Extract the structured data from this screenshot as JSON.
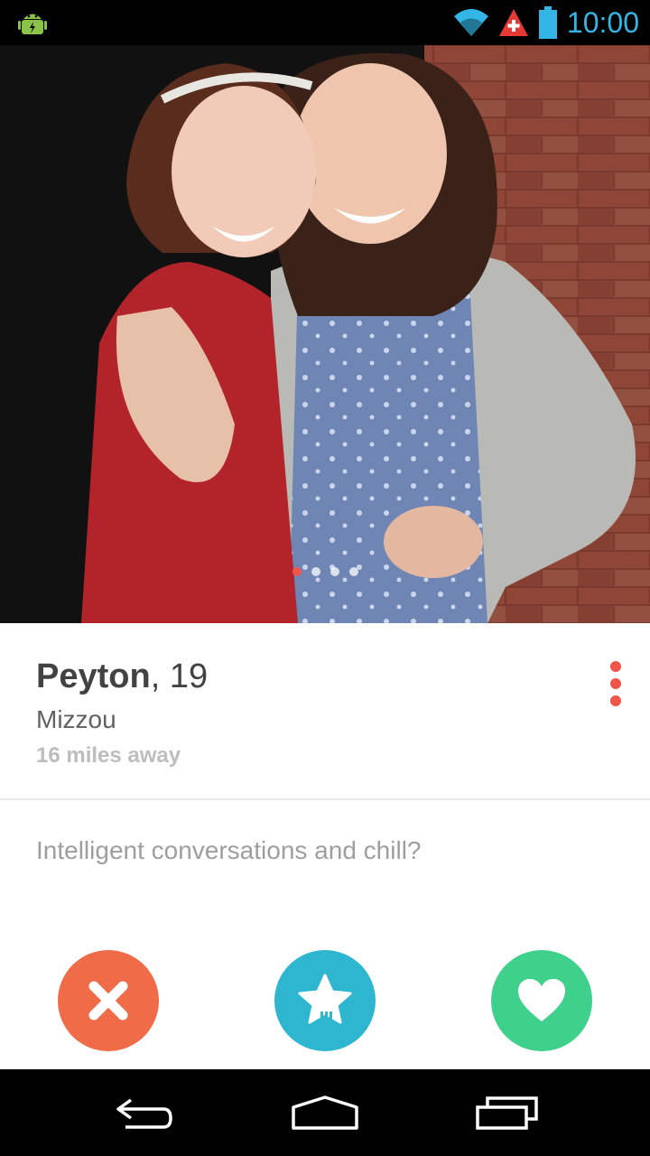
{
  "status_bar": {
    "time": "10:00"
  },
  "profile": {
    "name": "Peyton",
    "age_text": ", 19",
    "school": "Mizzou",
    "distance": "16 miles away",
    "bio": "Intelligent conversations and chill?"
  },
  "photo": {
    "count": 4,
    "active_index": 0
  },
  "colors": {
    "accent": "#f0554c",
    "nope": "#f06b48",
    "super_like": "#2eb6d0",
    "like": "#3fd18b",
    "status_time": "#33b5e5"
  },
  "icons": {
    "nope": "close-icon",
    "super_like": "star-icon",
    "like": "heart-icon",
    "more": "more-vertical-icon"
  },
  "nav": [
    "back-icon",
    "home-icon",
    "recents-icon"
  ]
}
